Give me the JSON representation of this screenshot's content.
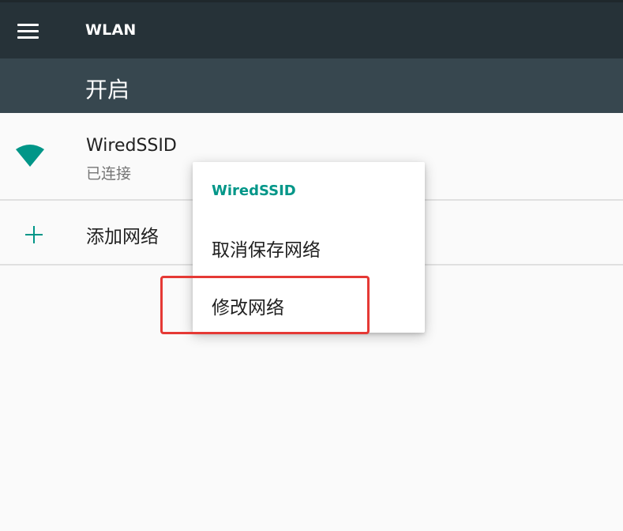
{
  "app_bar": {
    "title": "WLAN",
    "menu_icon": "menu-icon"
  },
  "switch_bar": {
    "label": "开启"
  },
  "networks": [
    {
      "name": "WiredSSID",
      "status": "已连接",
      "icon": "wifi-signal-icon"
    }
  ],
  "add_network": {
    "label": "添加网络",
    "icon": "plus-icon"
  },
  "context_menu": {
    "title": "WiredSSID",
    "items": [
      "取消保存网络",
      "修改网络"
    ]
  },
  "colors": {
    "app_bar": "#263238",
    "switch_bar": "#37474f",
    "accent": "#009688",
    "highlight": "#e53935"
  }
}
